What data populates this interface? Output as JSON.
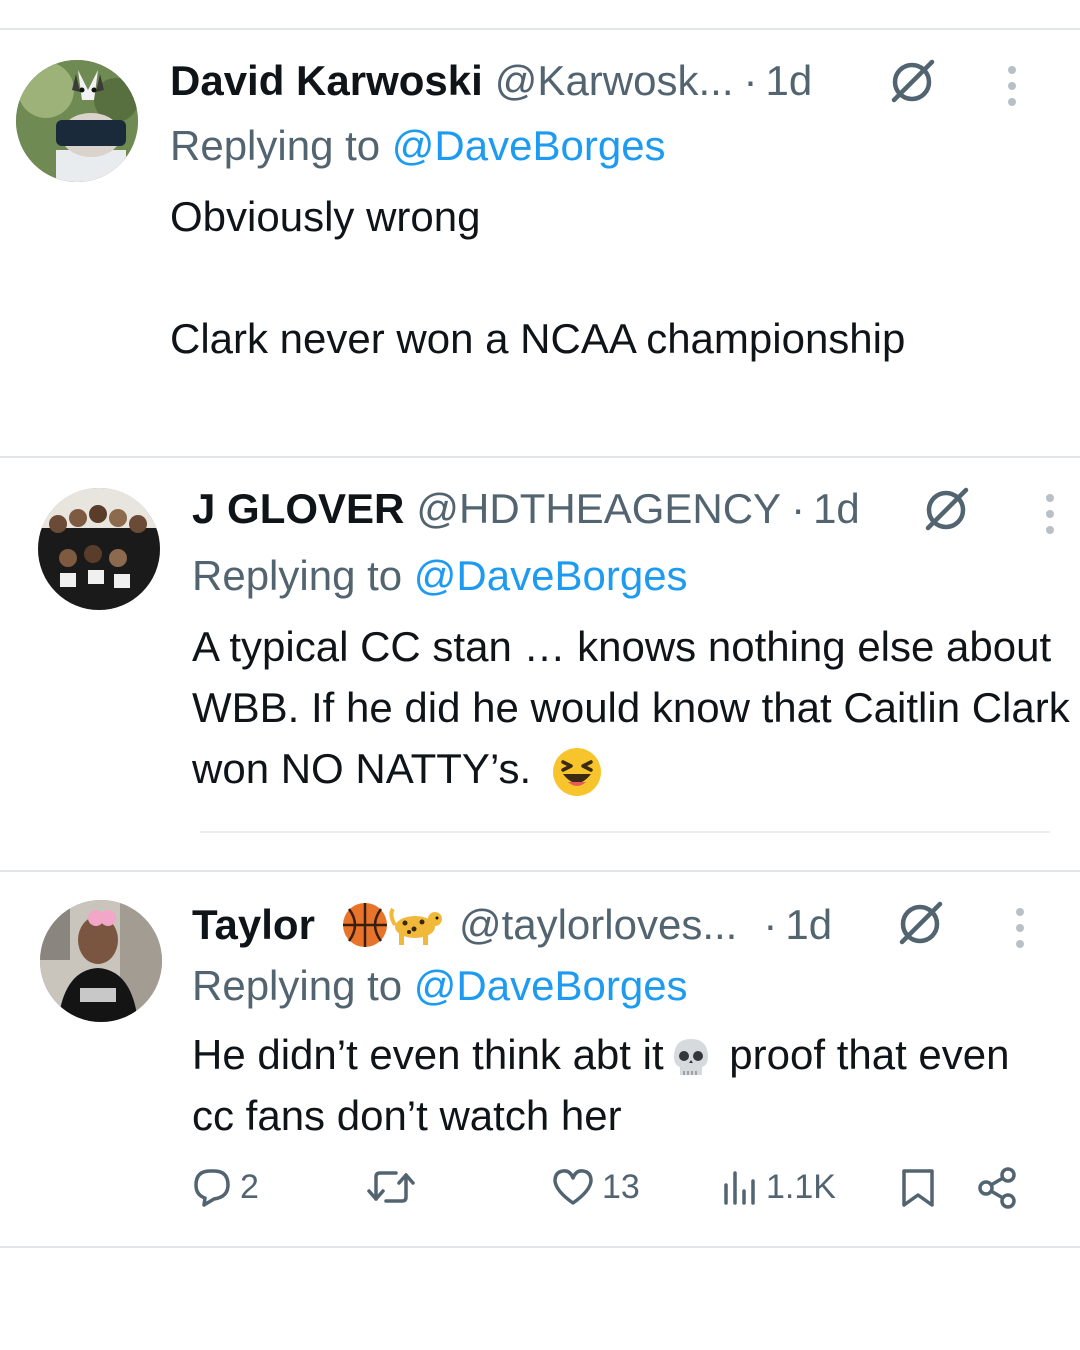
{
  "tweets": [
    {
      "name": "David Karwoski",
      "handle": "@Karwosk...",
      "separator": "·",
      "time": "1d",
      "replying_prefix": "Replying to ",
      "replying_to": "@DaveBorges",
      "paragraphs": [
        "Obviously wrong",
        "Clark never won a NCAA championship"
      ],
      "avatar_icon": "husky-mask-avatar"
    },
    {
      "name": "J GLOVER",
      "handle": "@HDTHEAGENCY",
      "separator": "·",
      "time": "1d",
      "replying_prefix": "Replying to ",
      "replying_to": "@DaveBorges",
      "paragraphs": [
        "A typical CC stan … knows nothing else about WBB. If he did he would know that Caitlin Clark won NO NATTY’s."
      ],
      "emoji": "laughing-squint-emoji",
      "avatar_icon": "team-photo-avatar"
    },
    {
      "name": "Taylor",
      "name_emojis": [
        "basketball-emoji",
        "leopard-emoji"
      ],
      "handle": "@taylorloves...",
      "separator": "·",
      "time": "1d",
      "replying_prefix": "Replying to ",
      "replying_to": "@DaveBorges",
      "text_before_emoji": "He didn’t even think abt it",
      "emoji": "skull-emoji",
      "text_after_emoji": " proof that even cc fans don’t watch her",
      "avatar_icon": "fan-photo-avatar"
    }
  ],
  "actions": {
    "replies": "2",
    "retweets": "",
    "likes": "13",
    "views": "1.1K"
  },
  "colors": {
    "text": "#0f1419",
    "secondary": "#536471",
    "link": "#1d9bf0",
    "divider": "#e3e6e8"
  }
}
